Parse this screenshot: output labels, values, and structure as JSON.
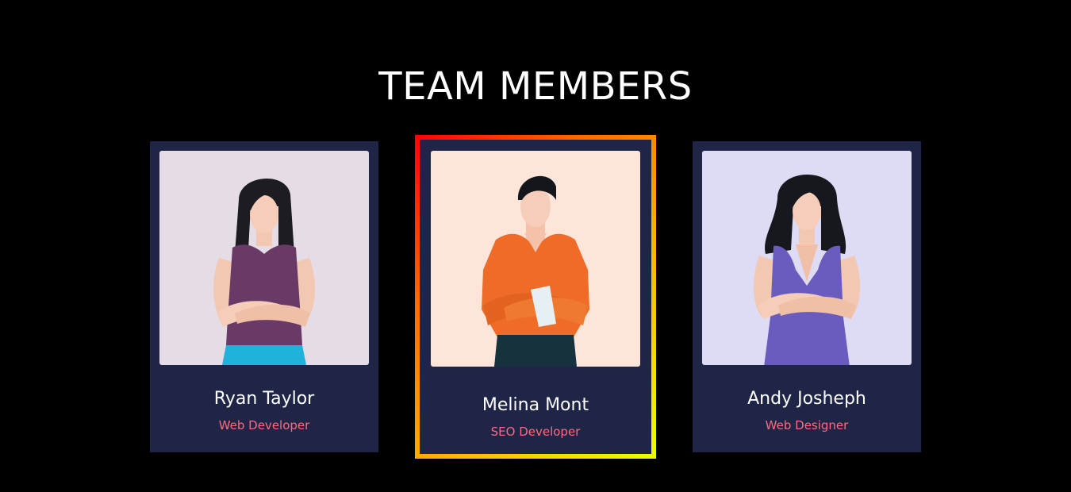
{
  "section": {
    "title": "TEAM MEMBERS"
  },
  "members": [
    {
      "name": "Ryan Taylor",
      "role": "Web Developer",
      "avatar_icon": "woman-crossed-arms-avatar",
      "photo_bg": "#e6dce6",
      "active": false
    },
    {
      "name": "Melina Mont",
      "role": "SEO Developer",
      "avatar_icon": "man-crossed-arms-avatar",
      "photo_bg": "#fde5da",
      "active": true
    },
    {
      "name": "Andy Josheph",
      "role": "Web Designer",
      "avatar_icon": "woman-crossed-arms-avatar",
      "photo_bg": "#dedcf4",
      "active": false
    }
  ],
  "colors": {
    "page_bg": "#000000",
    "card_bg": "#1f2546",
    "name_text": "#ffffff",
    "role_text": "#ff6b7e",
    "active_border_gradient": [
      "#ff0000",
      "#ff6a00",
      "#ffb000",
      "#eaff00"
    ]
  }
}
